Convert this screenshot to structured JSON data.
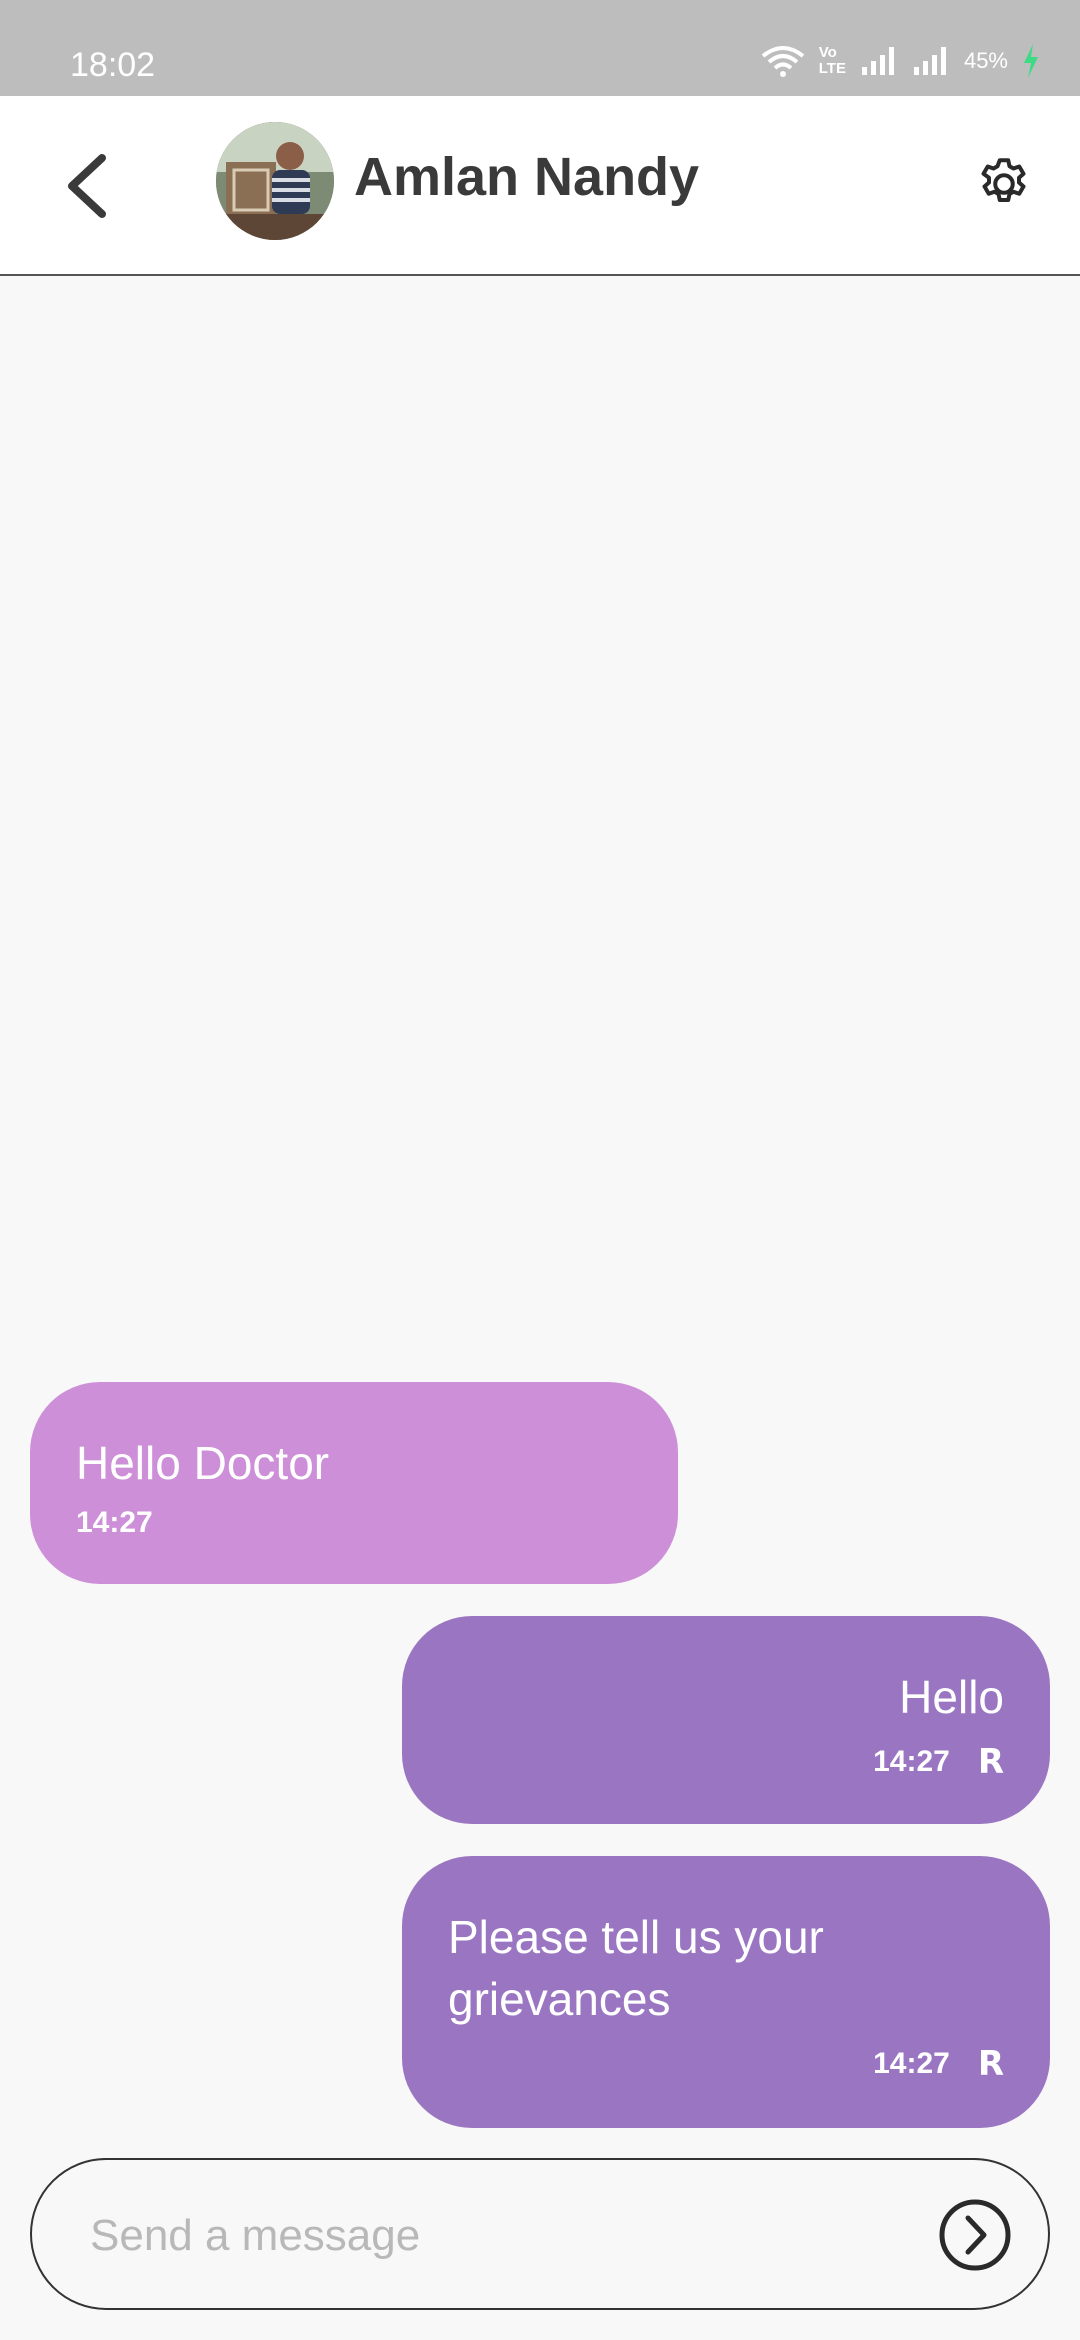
{
  "status_bar": {
    "time": "18:02",
    "battery_percent": "45%",
    "network_label_top": "Vo",
    "network_label_bottom": "LTE",
    "icons": [
      "wifi-icon",
      "volte-icon",
      "signal-icon",
      "signal-icon",
      "battery-charging-icon"
    ]
  },
  "header": {
    "contact_name": "Amlan Nandy",
    "back_icon": "chevron-left-icon",
    "settings_icon": "gear-icon"
  },
  "messages": [
    {
      "direction": "incoming",
      "text": "Hello Doctor",
      "time": "14:27",
      "receipt": ""
    },
    {
      "direction": "outgoing",
      "text": "Hello",
      "time": "14:27",
      "receipt": "R"
    },
    {
      "direction": "outgoing",
      "text": "Please tell us your grievances",
      "time": "14:27",
      "receipt": "R"
    }
  ],
  "composer": {
    "placeholder": "Send a message",
    "send_icon": "send-circle-chevron-icon"
  },
  "colors": {
    "incoming_bubble": "#cd90d8",
    "outgoing_bubble": "#9a76c2",
    "status_bar": "#bdbdbd",
    "charging": "#3ddc84"
  }
}
